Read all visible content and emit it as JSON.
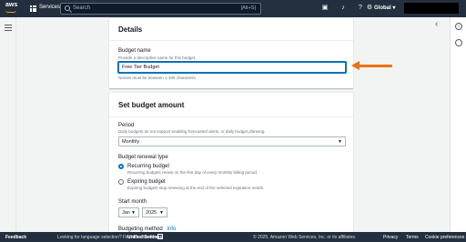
{
  "topbar": {
    "logo": "aws",
    "services": "Services",
    "search_placeholder": "Search",
    "search_shortcut": "[Alt+S]",
    "region": "Global ▾"
  },
  "details": {
    "title": "Details",
    "budget_name_label": "Budget name",
    "budget_name_desc": "Provide a descriptive name for this budget.",
    "budget_name_value": "Free Tier Budget",
    "budget_name_hint": "Names must be between 1-100 characters."
  },
  "amount": {
    "title": "Set budget amount",
    "period_label": "Period",
    "period_desc": "Daily budgets do not support enabling forecasted alerts, or daily budget planning.",
    "period_value": "Monthly",
    "renewal_label": "Budget renewal type",
    "recurring_label": "Recurring budget",
    "recurring_desc": "Recurring budgets renew on the first day of every monthly billing period.",
    "expiring_label": "Expiring budget",
    "expiring_desc": "Expiring budgets stop renewing at the end of the selected expiration month.",
    "start_month_label": "Start month",
    "start_month_value": "Jan",
    "start_year_value": "2025",
    "budgeting_method_label": "Budgeting method",
    "info_link": "Info"
  },
  "footer": {
    "feedback": "Feedback",
    "language_prompt": "Looking for language selection? Find it in the new",
    "unified_settings": "Unified Settings",
    "copyright": "© 2025, Amazon Web Services, Inc. or its affiliates.",
    "privacy": "Privacy",
    "terms": "Terms",
    "cookie": "Cookie preferences"
  },
  "colors": {
    "topbar": "#232f3e",
    "accent": "#0073bb",
    "annotation_arrow": "#ec7211"
  }
}
